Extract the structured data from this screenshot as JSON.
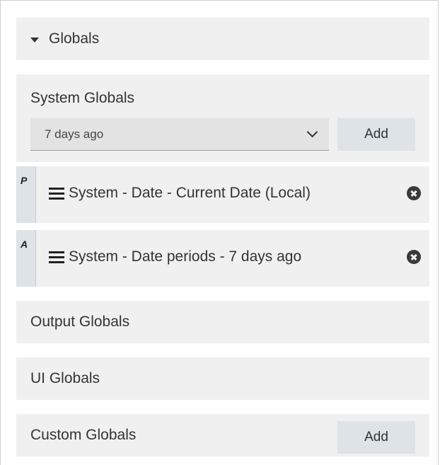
{
  "globals_header": {
    "label": "Globals"
  },
  "system_globals": {
    "title": "System Globals",
    "select_value": "7 days ago",
    "add_label": "Add"
  },
  "items": [
    {
      "tag": "P",
      "text": "System - Date - Current Date (Local)"
    },
    {
      "tag": "A",
      "text": "System - Date periods - 7 days ago"
    }
  ],
  "output_globals": {
    "title": "Output Globals"
  },
  "ui_globals": {
    "title": "UI Globals"
  },
  "custom_globals": {
    "title": "Custom Globals",
    "add_label": "Add"
  }
}
